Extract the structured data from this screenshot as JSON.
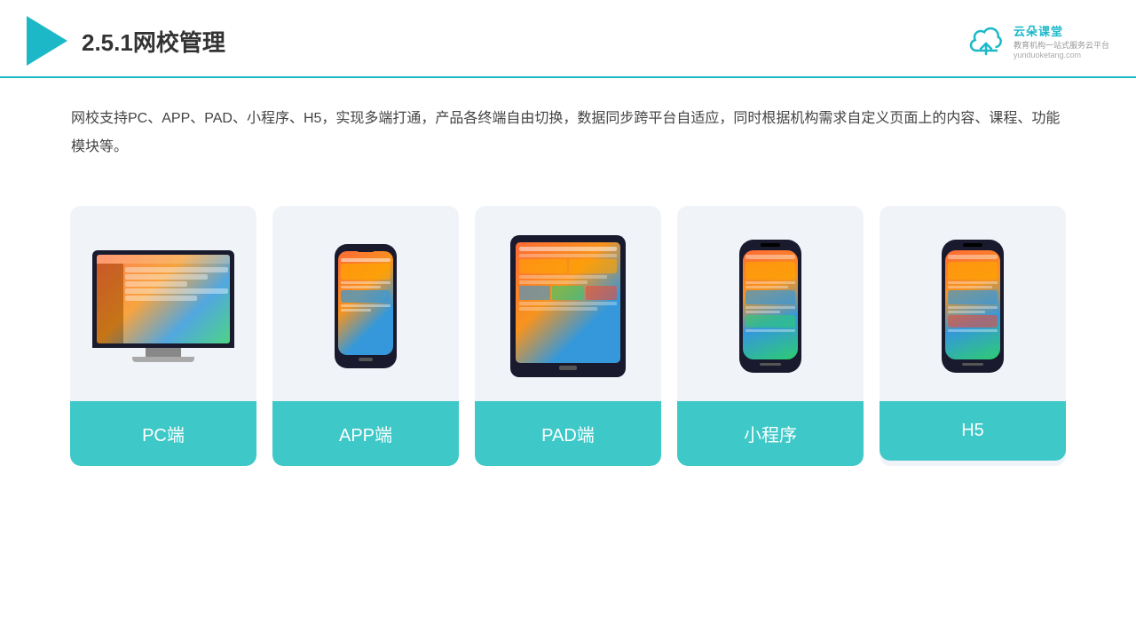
{
  "header": {
    "title": "2.5.1网校管理",
    "logo_main": "云朵课堂",
    "logo_sub": "教育机构一站\n式服务云平台",
    "logo_url": "yunduoketang.com"
  },
  "description": {
    "text": "网校支持PC、APP、PAD、小程序、H5，实现多端打通，产品各终端自由切换，数据同步跨平台自适应，同时根据机构需求自定义页面上的内容、课程、功能模块等。"
  },
  "cards": [
    {
      "id": "pc",
      "label": "PC端"
    },
    {
      "id": "app",
      "label": "APP端"
    },
    {
      "id": "pad",
      "label": "PAD端"
    },
    {
      "id": "miniprogram",
      "label": "小程序"
    },
    {
      "id": "h5",
      "label": "H5"
    }
  ]
}
